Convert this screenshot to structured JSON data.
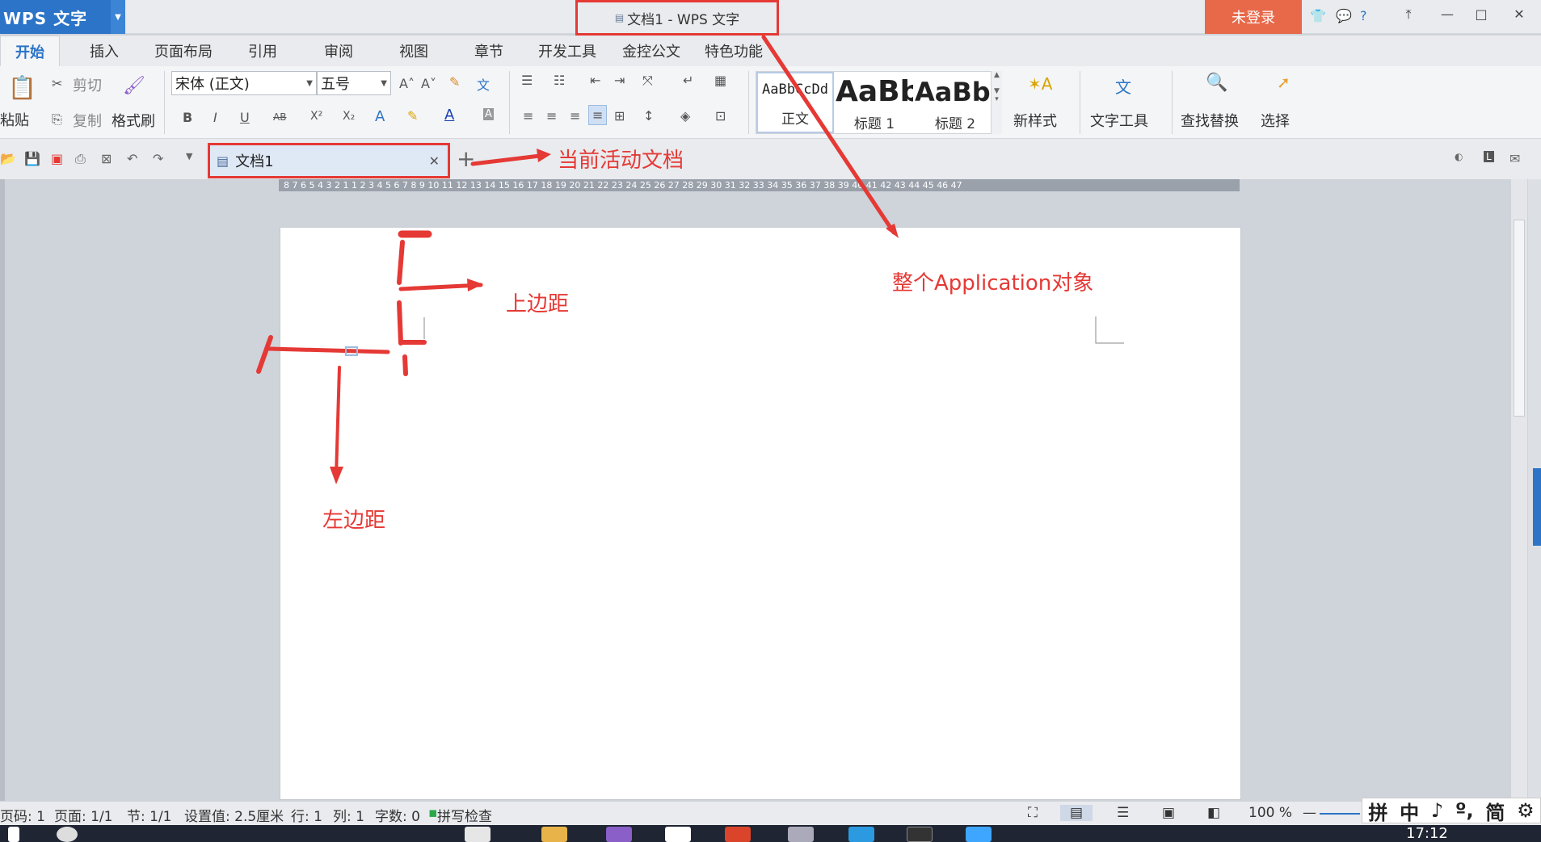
{
  "titlebar": {
    "app_name": "WPS 文字",
    "title": "文档1 - WPS 文字",
    "login": "未登录"
  },
  "tabs": [
    "开始",
    "插入",
    "页面布局",
    "引用",
    "审阅",
    "视图",
    "章节",
    "开发工具",
    "金控公文",
    "特色功能"
  ],
  "ribbon": {
    "paste": "粘贴",
    "cut": "剪切",
    "copy": "复制",
    "format_painter": "格式刷",
    "font_name": "宋体 (正文)",
    "font_size": "五号",
    "bold": "B",
    "italic": "I",
    "underline": "U",
    "strike": "AB",
    "superscript": "X²",
    "subscript": "X₂",
    "styles": [
      {
        "preview": "AaBbCcDd",
        "label": "正文"
      },
      {
        "preview": "AaBb",
        "label": "标题 1"
      },
      {
        "preview": "AaBb(",
        "label": "标题 2"
      }
    ],
    "new_style": "新样式",
    "text_tools": "文字工具",
    "find_replace": "查找替换",
    "select": "选择"
  },
  "docbar": {
    "doc_tab": "文档1"
  },
  "ruler_text": "8 7 6 5 4 3 2 1 1 2 3 4 5 6 7 8 9 10 11 12 13 14 15 16 17 18 19 20 21 22 23 24 25 26 27 28 29 30 31 32 33 34 35 36 37 38 39 40 41 42 43 44 45 46 47",
  "annotations": {
    "active_doc": "当前活动文档",
    "application": "整个Application对象",
    "top_margin": "上边距",
    "left_margin": "左边距"
  },
  "statusbar": {
    "page_num": "页码: 1",
    "pages": "页面: 1/1",
    "section": "节: 1/1",
    "setting": "设置值: 2.5厘米",
    "row": "行: 1",
    "col": "列: 1",
    "words": "字数: 0",
    "spell": "拼写检查",
    "zoom": "100 %"
  },
  "ime": [
    "拼",
    "中",
    "♪",
    "º,",
    "简",
    "⚙"
  ],
  "taskbar": {
    "clock": "17:12"
  },
  "colors": {
    "accent": "#2b74c7",
    "login": "#e8684a",
    "annotation": "#e53935"
  }
}
